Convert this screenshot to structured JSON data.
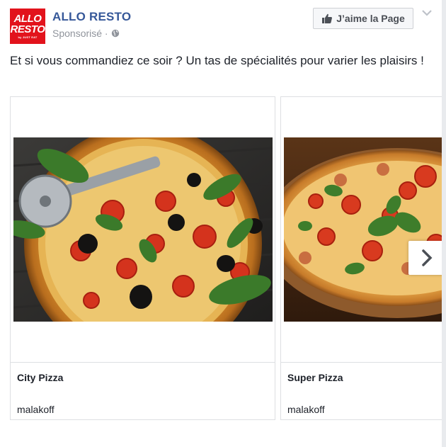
{
  "page": {
    "logo_lines": [
      "ALLO",
      "RESTO",
      "by JUST EAT"
    ],
    "name": "ALLO RESTO",
    "sponsored": "Sponsorisé ·",
    "like_label": "J’aime la Page"
  },
  "post": {
    "text": "Et si vous commandiez ce soir ? Un tas de spécialités pour varier les plaisirs !"
  },
  "cards": [
    {
      "title": "City Pizza",
      "subtitle": "malakoff",
      "image_icon": "pizza-photo"
    },
    {
      "title": "Super Pizza",
      "subtitle": "malakoff",
      "image_icon": "pizza-photo"
    }
  ],
  "colors": {
    "brand": "#e2131c",
    "link": "#365899",
    "muted": "#90949c",
    "border": "#dddfe2"
  },
  "icons": {
    "globe": "globe-icon",
    "like": "thumbs-up-icon",
    "menu": "chevron-down-icon",
    "next": "chevron-right-icon"
  }
}
